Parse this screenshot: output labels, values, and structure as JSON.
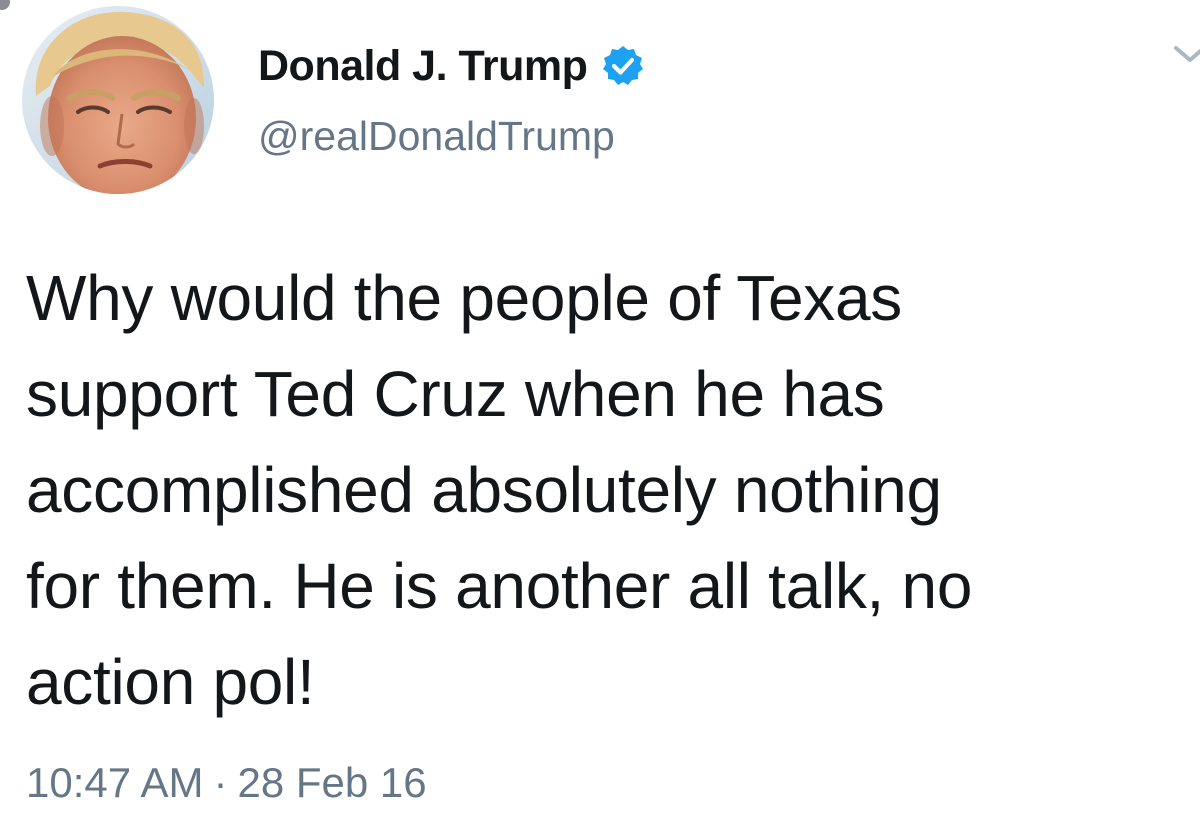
{
  "author": {
    "display_name": "Donald J. Trump",
    "handle": "@realDonaldTrump",
    "verified": true,
    "verified_icon": "verified-badge-icon",
    "avatar_icon": "profile-avatar"
  },
  "tweet": {
    "lines": [
      "Why would the people of Texas",
      "support Ted Cruz when he has",
      "accomplished absolutely nothing",
      "for them. He is another all talk, no",
      "action pol!"
    ]
  },
  "meta": {
    "time": "10:47 AM",
    "separator": "·",
    "date": "28 Feb 16"
  },
  "colors": {
    "verified_blue": "#1da1f2",
    "secondary_text": "#657786",
    "primary_text": "#14171a"
  },
  "icons": {
    "menu": "chevron-down-icon"
  }
}
